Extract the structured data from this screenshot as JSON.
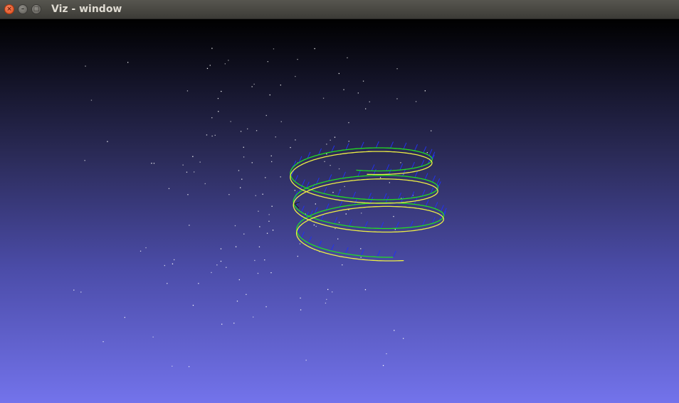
{
  "window": {
    "title": "Viz - window",
    "close_glyph": "×",
    "minimize_glyph": "–",
    "maximize_glyph": "□"
  },
  "scene": {
    "background_top": "#000000",
    "background_bottom": "#7373eb",
    "point_color": "#ffffff",
    "trajectory_colors": [
      "#22dd22",
      "#eeee44"
    ],
    "frame_marker_color": "#2233ee",
    "icons": [
      "close-icon",
      "minimize-icon",
      "maximize-icon"
    ]
  }
}
